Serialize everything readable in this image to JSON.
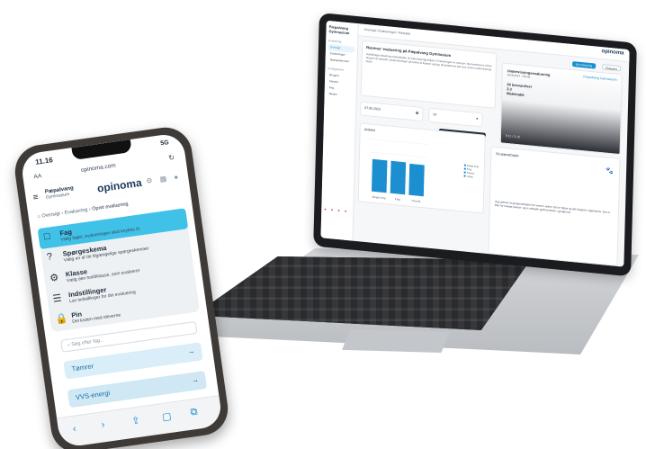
{
  "laptop": {
    "sidebar": {
      "logo": "Pæpalvang Gymnasium",
      "head1": "Evaluering",
      "items": [
        "Oversigt",
        "Evalueringer",
        "Spørgeskemaer"
      ],
      "head2": "Konfiguration",
      "items2": [
        "Brugere",
        "Klasser",
        "Fag",
        "Skolen"
      ]
    },
    "topbar": {
      "crumb": "Oversigt  /  Evalueringer  /  Resultat",
      "brand": "opinoma"
    },
    "intro": {
      "title": "Rasmus' evaluering på Pæpalvang Gymnasium",
      "body": "Udviklingsevaluering medarbejder af undervisningsmiljøet. Evalueringen er anonym. Besvarelserne bliver brugt til at forbedre undervisningen på tværs af klasser og fag. Resultaterne kan ses af den undervisende lærer."
    },
    "video": {
      "title": "Undervisningsevaluering",
      "subtitle": "2023/2024 · Efterår",
      "bold1": "24 besvarelser",
      "bold2": "2.3",
      "bold3": "Matematik",
      "brand": "Pæpalvang Gymnasium",
      "time": "0:11 / 2:15"
    },
    "buttons": {
      "primary": "Ny evaluering",
      "secondary": "Eksporter"
    },
    "date": "07.05.2023",
    "count": "24",
    "tooltip": "Du er godt til at engagere dine elever",
    "chart_title": "Aktivitet",
    "legend": [
      "Meget enig",
      "Enig",
      "Neutral",
      "Uenig"
    ],
    "group": {
      "title": "Gruppearbejde",
      "text": "Jeg oplever at gruppearbejdet har været i orden. Det er tilpas og det fungerer organiseret. Der er ikke for mange pauser, og vi arbejder godt sammen i grupperne."
    }
  },
  "phone": {
    "status_time": "11.16",
    "status_icons": "5G",
    "url": "opinoma.com",
    "aa": "AA",
    "logo_line1": "Pæpalvang",
    "logo_line2": "Gymnasium",
    "brand": "opinoma",
    "crumbs": [
      "Oversigt",
      "Evaluering",
      "Opret evaluering"
    ],
    "menu": [
      {
        "icon": "□",
        "title": "Fag",
        "sub": "Vælg faget, evalueringen skal knyttes til"
      },
      {
        "icon": "?",
        "title": "Spørgeskema",
        "sub": "Vælg en af de tilgængelige spørgeskemaer"
      },
      {
        "icon": "⚙",
        "title": "Klasse",
        "sub": "Vælg den hold/klasse, som evaluerer"
      },
      {
        "icon": "☰",
        "title": "Indstillinger",
        "sub": "Lav indstillinger for din evaluering"
      },
      {
        "icon": "🔒",
        "title": "Pin",
        "sub": "Del koden med eleverne"
      }
    ],
    "search_placeholder": "Søg efter fag...",
    "rows": [
      "Tømrer",
      "VVS-energi"
    ],
    "bottom_icons": [
      "‹",
      "›",
      "⇪",
      "▢",
      "⧉"
    ]
  },
  "chart_data": {
    "type": "bar",
    "categories": [
      "Meget enig",
      "Enig",
      "Neutral"
    ],
    "values": [
      62,
      62,
      60
    ],
    "title": "Aktivitet",
    "xlabel": "",
    "ylabel": "",
    "ylim": [
      0,
      100
    ],
    "colors": [
      "#1b8fcf"
    ]
  }
}
